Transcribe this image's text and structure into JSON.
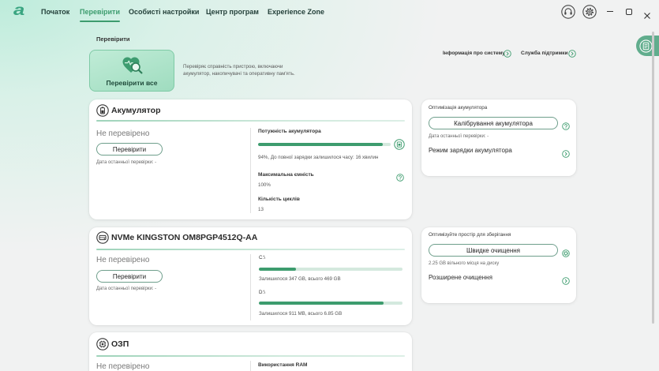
{
  "app": {
    "logo_text": "a"
  },
  "nav": {
    "tabs": [
      {
        "label": "Початок",
        "active": false
      },
      {
        "label": "Перевірити",
        "active": true
      },
      {
        "label": "Особисті настройки",
        "active": false
      },
      {
        "label": "Центр програм",
        "active": false
      },
      {
        "label": "Experience Zone",
        "active": false
      }
    ]
  },
  "toolbar_icons": {
    "support": "headset-icon",
    "settings": "gear-icon"
  },
  "window_controls": {
    "minimize": "minimize-icon",
    "restore": "restore-icon",
    "close": "close-icon"
  },
  "side_tab": {
    "icon": "notes-icon"
  },
  "page": {
    "title": "Перевірити"
  },
  "check_all": {
    "label": "Перевірити все",
    "icon": "heart-magnifier-icon",
    "description_lines": [
      "Перевіряє справність пристрою, включаючи",
      "акумулятор, накопичувачі та оперативну пам'ять."
    ]
  },
  "links": {
    "system_info": "Інформація про систему",
    "support": "Служба підтримки",
    "icon": "arrow-circle-icon"
  },
  "battery": {
    "icon": "battery-icon",
    "title": "Акумулятор",
    "status": "Не перевірено",
    "check_button": "Перевірити",
    "last_check": "Дата останньої перевірки: -",
    "power_label": "Потужність акумулятора",
    "power_level": 0.94,
    "power_text": "94%, До повної зарядки залишилося часу: 16 хвилин",
    "power_icon": "battery-saver-icon",
    "capacity_label": "Максимальна ємність",
    "capacity_help_icon": "question-icon",
    "capacity_value": "100%",
    "cycles_label": "Кількість циклів",
    "cycles_value": "13"
  },
  "battery_panel": {
    "title": "Оптимізація акумулятора",
    "calibrate_button": "Калібрування акумулятора",
    "calibrate_help_icon": "question-icon",
    "last_check": "Дата останньої перевірки: -",
    "charge_mode": "Режим зарядки акумулятора",
    "charge_mode_icon": "arrow-circle-icon"
  },
  "storage": {
    "icon": "drive-icon",
    "title": "NVMe KINGSTON OM8PGP4512Q-AA",
    "status": "Не перевірено",
    "check_button": "Перевірити",
    "last_check": "Дата останньої перевірки: -",
    "drives": [
      {
        "label": "C:\\",
        "used_fraction": 0.26,
        "text": "Залишилося 347 GB, всього 469 GB"
      },
      {
        "label": "D:\\",
        "used_fraction": 0.87,
        "text": "Залишилося 911 MB, всього 6.85 GB"
      }
    ]
  },
  "storage_panel": {
    "title": "Оптимізуйте простір для зберігання",
    "quick_clean_button": "Швидке очищення",
    "quick_clean_icon": "gear-icon",
    "free_space": "2.25 GB вільного місця на диску",
    "advanced_clean": "Розширене очищення",
    "advanced_clean_icon": "arrow-circle-icon"
  },
  "ram": {
    "icon": "ram-chip-icon",
    "title": "ОЗП",
    "status": "Не перевірено",
    "usage_label": "Використання RAM"
  },
  "colors": {
    "accent": "#3d9c6e",
    "accent_light": "#9fdcbf",
    "accent_dark": "#2f7f5a",
    "track": "#d4e9de",
    "side_tab": "#61ad8d",
    "text_muted": "#7b7b7b"
  }
}
